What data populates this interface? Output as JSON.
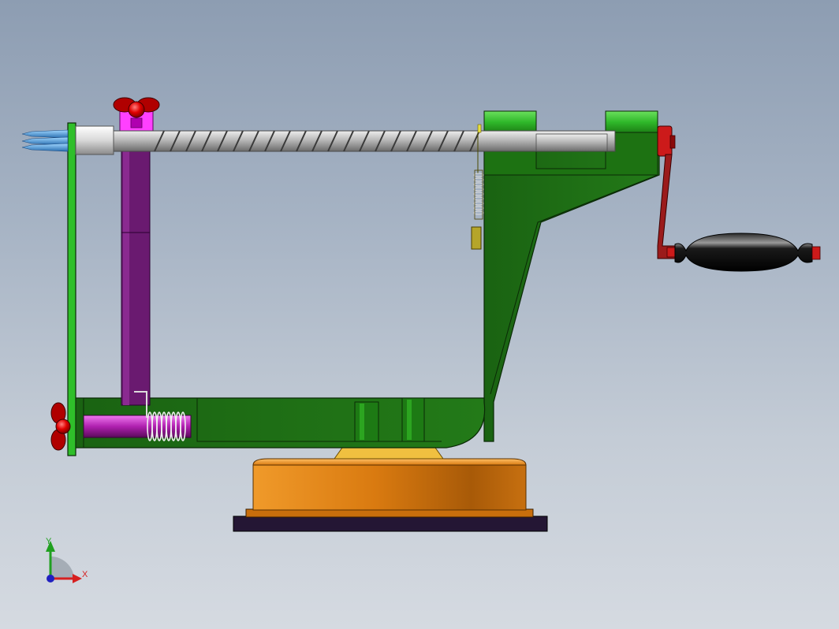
{
  "viewport": {
    "background_top": "#8d9db2",
    "background_bottom": "#d5dae1"
  },
  "model": {
    "colors": {
      "frame_green": "#1f6b14",
      "frame_green_light": "#2fbf2a",
      "magenta": "#e020e0",
      "purple": "#6a1a70",
      "red": "#cc0000",
      "crank_red": "#9b1b1b",
      "base_orange": "#d97a10",
      "base_dark": "#2a1a3a",
      "handle_black": "#0f0f0f",
      "screw_gray": "#a8a8a8",
      "spike_blue": "#4a9fd8",
      "bracket_yellow": "#b5a52a"
    },
    "parts": {
      "frame": "frame",
      "lead_screw": "lead-screw",
      "crank": "crank",
      "handle": "handle",
      "base": "base",
      "wing_nut_top": "wing-nut-top",
      "wing_nut_left": "wing-nut-left",
      "spring_bottom": "spring-bottom",
      "spring_top": "spring-top"
    }
  },
  "triad": {
    "x_label": "X",
    "y_label": "Y",
    "x_color": "#d62020",
    "y_color": "#20a020",
    "z_color": "#2020c0"
  }
}
